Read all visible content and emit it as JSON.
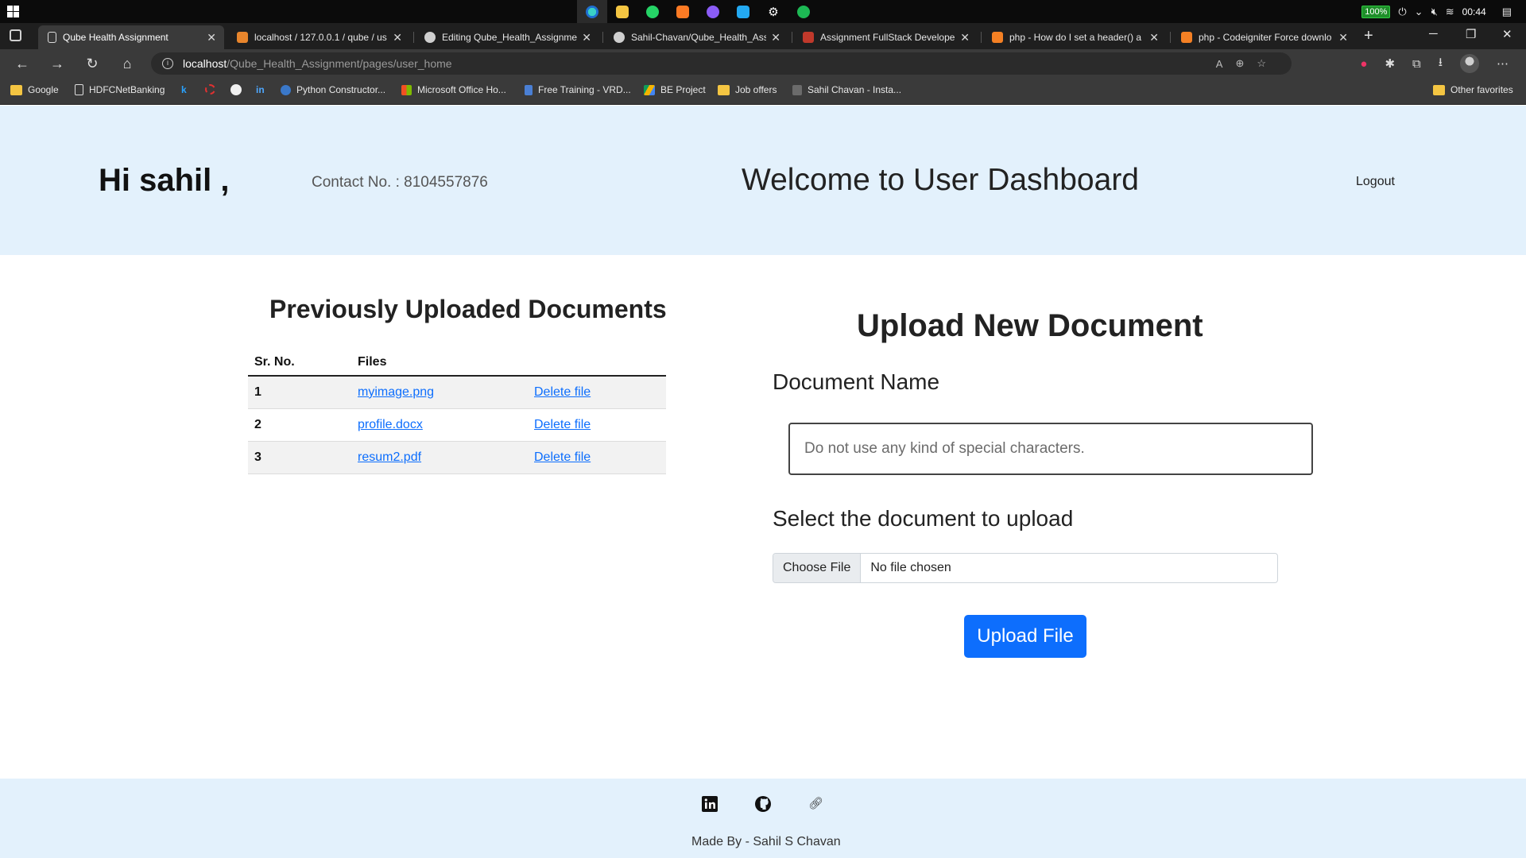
{
  "taskbar": {
    "battery": "100%",
    "clock": "00:44",
    "apps": [
      "edge-icon",
      "file-explorer-icon",
      "whatsapp-icon",
      "xampp-icon",
      "github-desktop-icon",
      "vscode-icon",
      "settings-icon",
      "spotify-icon"
    ]
  },
  "browser": {
    "tabs": [
      {
        "title": "Qube Health Assignment",
        "active": true
      },
      {
        "title": "localhost / 127.0.0.1 / qube / us",
        "active": false
      },
      {
        "title": "Editing Qube_Health_Assignmen",
        "active": false
      },
      {
        "title": "Sahil-Chavan/Qube_Health_Assi",
        "active": false
      },
      {
        "title": "Assignment FullStack Developer",
        "active": false
      },
      {
        "title": "php - How do I set a header() a",
        "active": false
      },
      {
        "title": "php - Codeigniter Force downlo",
        "active": false
      }
    ],
    "url_host": "localhost",
    "url_path": "/Qube_Health_Assignment/pages/user_home",
    "bookmarks": [
      "Google",
      "HDFCNetBanking",
      "k",
      "",
      "",
      "in",
      "Python Constructor...",
      "Microsoft Office Ho...",
      "Free Training - VRD...",
      "BE Project",
      "Job offers",
      "Sahil Chavan - Insta..."
    ],
    "other_favorites": "Other favorites"
  },
  "header": {
    "greeting": "Hi sahil ,",
    "contact": "Contact No. : 8104557876",
    "welcome": "Welcome to User Dashboard",
    "logout": "Logout"
  },
  "documents": {
    "title": "Previously Uploaded Documents",
    "columns": [
      "Sr. No.",
      "Files",
      ""
    ],
    "rows": [
      {
        "sr": "1",
        "file": "myimage.png",
        "action": "Delete file"
      },
      {
        "sr": "2",
        "file": "profile.docx",
        "action": "Delete file"
      },
      {
        "sr": "3",
        "file": "resum2.pdf",
        "action": "Delete file"
      }
    ]
  },
  "upload": {
    "title": "Upload New Document",
    "doc_name_label": "Document Name",
    "doc_name_placeholder": "Do not use any kind of special characters.",
    "select_label": "Select the document to upload",
    "choose_file": "Choose File",
    "file_status": "No file chosen",
    "submit": "Upload File"
  },
  "footer": {
    "icons": [
      "linkedin-icon",
      "github-icon",
      "link-icon"
    ],
    "made_by": "Made By - Sahil S Chavan"
  },
  "colors": {
    "header_bg": "#e3f1fc",
    "primary": "#0d6efd",
    "taskbar_bg": "#0b0b0b",
    "browser_chrome": "#3a3a3a"
  }
}
